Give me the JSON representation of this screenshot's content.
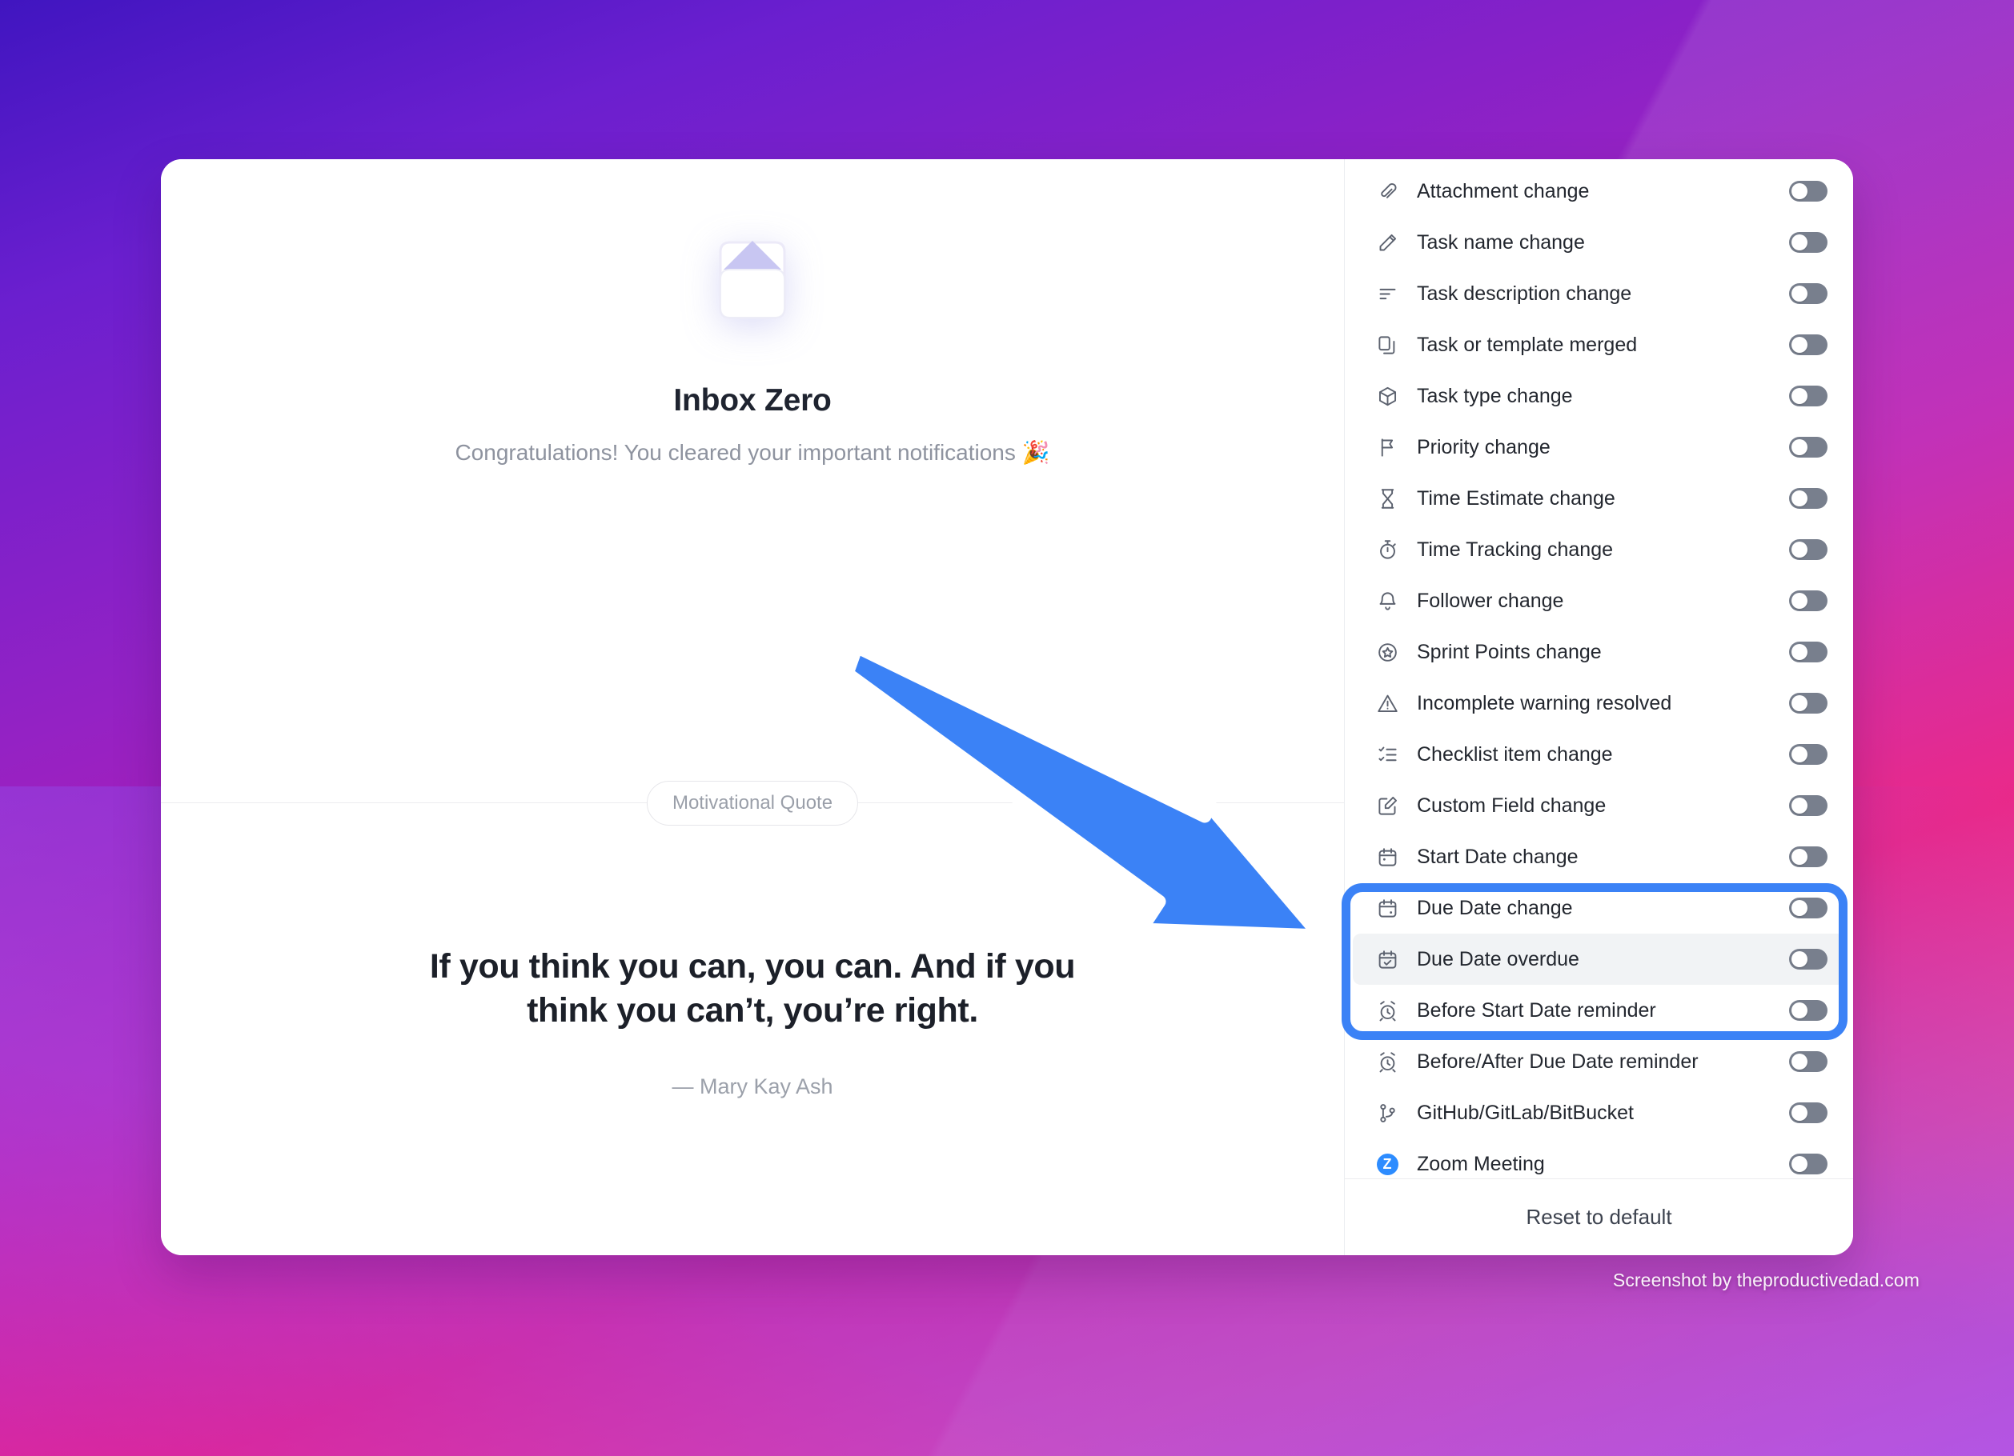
{
  "background": {
    "gradient_from": "#4015c0",
    "gradient_mid": "#bb1ab0",
    "gradient_to": "#e8117c"
  },
  "inbox": {
    "icon": "inbox-tray-icon",
    "title": "Inbox Zero",
    "subtitle": "Congratulations! You cleared your important notifications 🎉",
    "quote_badge": "Motivational Quote",
    "quote_text": "If you think you can, you can. And if you think you can’t, you’re right.",
    "quote_author": "— Mary Kay Ash"
  },
  "settings_panel": {
    "reset_label": "Reset to default",
    "toggle_on_color": "#3b82f6",
    "toggle_off_color": "#787f8d",
    "items": [
      {
        "icon": "paperclip-icon",
        "label": "Attachment change",
        "enabled": false,
        "hovered": false
      },
      {
        "icon": "pencil-icon",
        "label": "Task name change",
        "enabled": false,
        "hovered": false
      },
      {
        "icon": "text-lines-icon",
        "label": "Task description change",
        "enabled": false,
        "hovered": false
      },
      {
        "icon": "copy-merge-icon",
        "label": "Task or template merged",
        "enabled": false,
        "hovered": false
      },
      {
        "icon": "cube-icon",
        "label": "Task type change",
        "enabled": false,
        "hovered": false
      },
      {
        "icon": "flag-icon",
        "label": "Priority change",
        "enabled": false,
        "hovered": false
      },
      {
        "icon": "hourglass-icon",
        "label": "Time Estimate change",
        "enabled": false,
        "hovered": false
      },
      {
        "icon": "stopwatch-icon",
        "label": "Time Tracking change",
        "enabled": false,
        "hovered": false
      },
      {
        "icon": "bell-icon",
        "label": "Follower change",
        "enabled": false,
        "hovered": false
      },
      {
        "icon": "star-circle-icon",
        "label": "Sprint Points change",
        "enabled": false,
        "hovered": false
      },
      {
        "icon": "warning-triangle-icon",
        "label": "Incomplete warning resolved",
        "enabled": false,
        "hovered": false
      },
      {
        "icon": "checklist-icon",
        "label": "Checklist item change",
        "enabled": false,
        "hovered": false
      },
      {
        "icon": "edit-square-icon",
        "label": "Custom Field change",
        "enabled": false,
        "hovered": false
      },
      {
        "icon": "calendar-start-icon",
        "label": "Start Date change",
        "enabled": false,
        "hovered": false
      },
      {
        "icon": "calendar-due-icon",
        "label": "Due Date change",
        "enabled": false,
        "hovered": false
      },
      {
        "icon": "calendar-check-icon",
        "label": "Due Date overdue",
        "enabled": false,
        "hovered": true
      },
      {
        "icon": "alarm-clock-icon",
        "label": "Before Start Date reminder",
        "enabled": false,
        "hovered": false
      },
      {
        "icon": "alarm-clock-icon",
        "label": "Before/After Due Date reminder",
        "enabled": false,
        "hovered": false
      },
      {
        "icon": "git-branch-icon",
        "label": "GitHub/GitLab/BitBucket",
        "enabled": false,
        "hovered": false
      },
      {
        "icon": "zoom-logo-icon",
        "label": "Zoom Meeting",
        "enabled": false,
        "hovered": false
      }
    ]
  },
  "annotations": {
    "arrow": {
      "name": "blue-arrow-annotation",
      "color": "#3b82f6"
    },
    "highlight_box": {
      "name": "blue-highlight-box",
      "color": "#3b82f6",
      "targets": "Due Date overdue"
    }
  },
  "watermark": "Screenshot by theproductivedad.com"
}
